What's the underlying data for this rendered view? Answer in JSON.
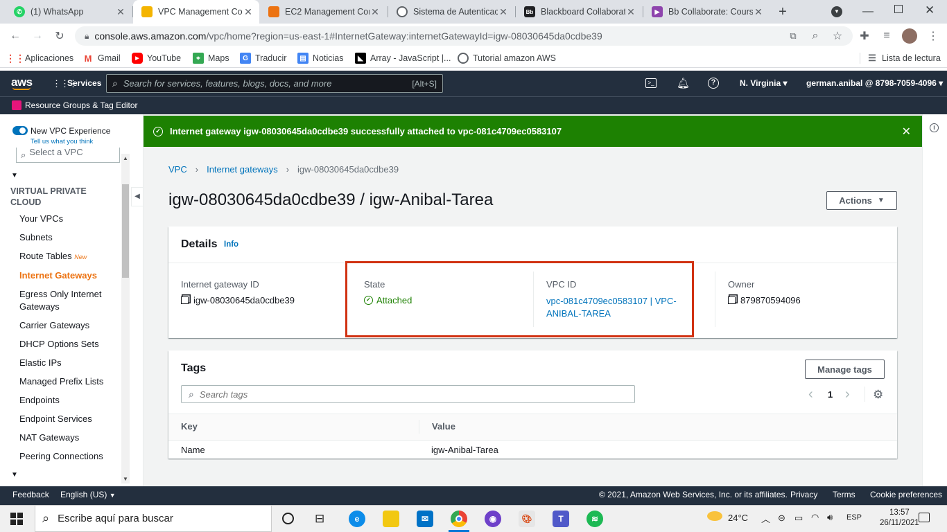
{
  "browser": {
    "tabs": [
      {
        "title": "(1) WhatsApp",
        "color": "#25d366"
      },
      {
        "title": "VPC Management Con",
        "color": "#f4b400"
      },
      {
        "title": "EC2 Management Con",
        "color": "#ec7211"
      },
      {
        "title": "Sistema de Autenticac",
        "color": "#5f6368"
      },
      {
        "title": "Blackboard Collaborat",
        "color": "#202124"
      },
      {
        "title": "Bb Collaborate: Cours",
        "color": "#8e44ad"
      }
    ],
    "url_host": "console.aws.amazon.com",
    "url_path": "/vpc/home?region=us-east-1#InternetGateway:internetGatewayId=igw-08030645da0cdbe39",
    "bookmarks": [
      "Aplicaciones",
      "Gmail",
      "YouTube",
      "Maps",
      "Traducir",
      "Noticias",
      "Array - JavaScript |...",
      "Tutorial amazon AWS"
    ],
    "reading_list": "Lista de lectura"
  },
  "aws": {
    "logo": "aws",
    "services": "Services",
    "search_placeholder": "Search for services, features, blogs, docs, and more",
    "search_shortcut": "[Alt+S]",
    "region": "N. Virginia",
    "account": "german.anibal @ 8798-7059-4096",
    "resource_groups": "Resource Groups & Tag Editor"
  },
  "sidebar": {
    "toggle_label": "New VPC Experience",
    "toggle_sub": "Tell us what you think",
    "select_vpc_placeholder": "Select a VPC",
    "section": "VIRTUAL PRIVATE CLOUD",
    "items": [
      {
        "label": "Your VPCs"
      },
      {
        "label": "Subnets"
      },
      {
        "label": "Route Tables",
        "badge": "New"
      },
      {
        "label": "Internet Gateways",
        "active": true
      },
      {
        "label": "Egress Only Internet Gateways"
      },
      {
        "label": "Carrier Gateways"
      },
      {
        "label": "DHCP Options Sets"
      },
      {
        "label": "Elastic IPs"
      },
      {
        "label": "Managed Prefix Lists"
      },
      {
        "label": "Endpoints"
      },
      {
        "label": "Endpoint Services"
      },
      {
        "label": "NAT Gateways"
      },
      {
        "label": "Peering Connections"
      }
    ]
  },
  "banner": {
    "message": "Internet gateway igw-08030645da0cdbe39 successfully attached to vpc-081c4709ec0583107"
  },
  "breadcrumb": {
    "root": "VPC",
    "section": "Internet gateways",
    "current": "igw-08030645da0cdbe39"
  },
  "page_title": "igw-08030645da0cdbe39 / igw-Anibal-Tarea",
  "actions_label": "Actions",
  "details": {
    "heading": "Details",
    "info": "Info",
    "igw_label": "Internet gateway ID",
    "igw_value": "igw-08030645da0cdbe39",
    "state_label": "State",
    "state_value": "Attached",
    "vpc_label": "VPC ID",
    "vpc_value_line1": "vpc-081c4709ec0583107 | VPC-",
    "vpc_value_line2": "ANIBAL-TAREA",
    "owner_label": "Owner",
    "owner_value": "879870594096"
  },
  "tags": {
    "heading": "Tags",
    "manage_label": "Manage tags",
    "search_placeholder": "Search tags",
    "page": "1",
    "col_key": "Key",
    "col_value": "Value",
    "rows": [
      {
        "key": "Name",
        "value": "igw-Anibal-Tarea"
      }
    ]
  },
  "footer": {
    "feedback": "Feedback",
    "language": "English (US)",
    "copyright": "© 2021, Amazon Web Services, Inc. or its affiliates.",
    "privacy": "Privacy",
    "terms": "Terms",
    "cookies": "Cookie preferences"
  },
  "taskbar": {
    "search_placeholder": "Escribe aquí para buscar",
    "temperature": "24°C",
    "lang": "ESP",
    "time": "13:57",
    "date": "26/11/2021"
  },
  "colors": {
    "accent": "#ec7211",
    "success": "#1d8102",
    "link": "#0073bb",
    "highlight": "#d13212",
    "aws_nav": "#232f3e"
  }
}
